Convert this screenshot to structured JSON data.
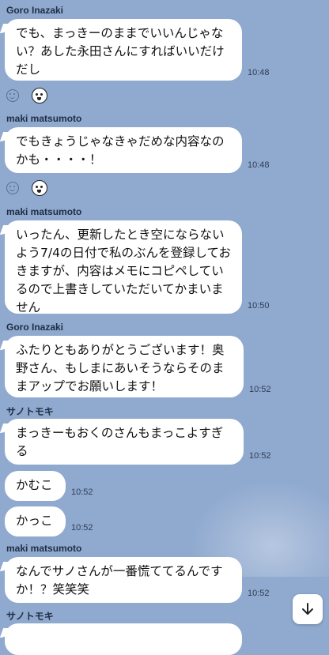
{
  "messages": [
    {
      "sender": "Goro Inazaki",
      "text": "でも、まっきーのままでいいんじゃない？あした永田さんにすればいいだけだし",
      "time": "10:48"
    },
    {
      "sender": "maki matsumoto",
      "text": "でもきょうじゃなきゃだめな内容なのかも・・・・！",
      "time": "10:48"
    },
    {
      "sender": "maki matsumoto",
      "text": "いったん、更新したとき空にならないよう7/4の日付で私のぶんを登録しておきますが、内容はメモにコピペしているので上書きしていただいてかまいません",
      "time": "10:50"
    },
    {
      "sender": "Goro Inazaki",
      "text": "ふたりともありがとうございます！奥野さん、もしまにあいそうならそのままアップでお願いします！",
      "time": "10:52"
    },
    {
      "sender": "サノトモキ",
      "text": "まっきーもおくのさんもまっこよすぎる",
      "time": "10:52"
    },
    {
      "text": "かむこ",
      "time": "10:52"
    },
    {
      "text": "かっこ",
      "time": "10:52"
    },
    {
      "sender": "maki matsumoto",
      "text": "なんでサノさんが一番慌ててるんですか！？笑笑笑",
      "time": "10:52"
    },
    {
      "sender": "サノトモキ",
      "text": "",
      "time": ""
    }
  ],
  "reactions": {
    "add_icon": "add-reaction-icon",
    "sticker_icon": "sticker-reaction-icon"
  },
  "scroll_button": {
    "icon": "arrow-down-icon"
  },
  "colors": {
    "background": "#8fa9cf",
    "bubble": "#ffffff",
    "sender": "#1f2d44"
  }
}
